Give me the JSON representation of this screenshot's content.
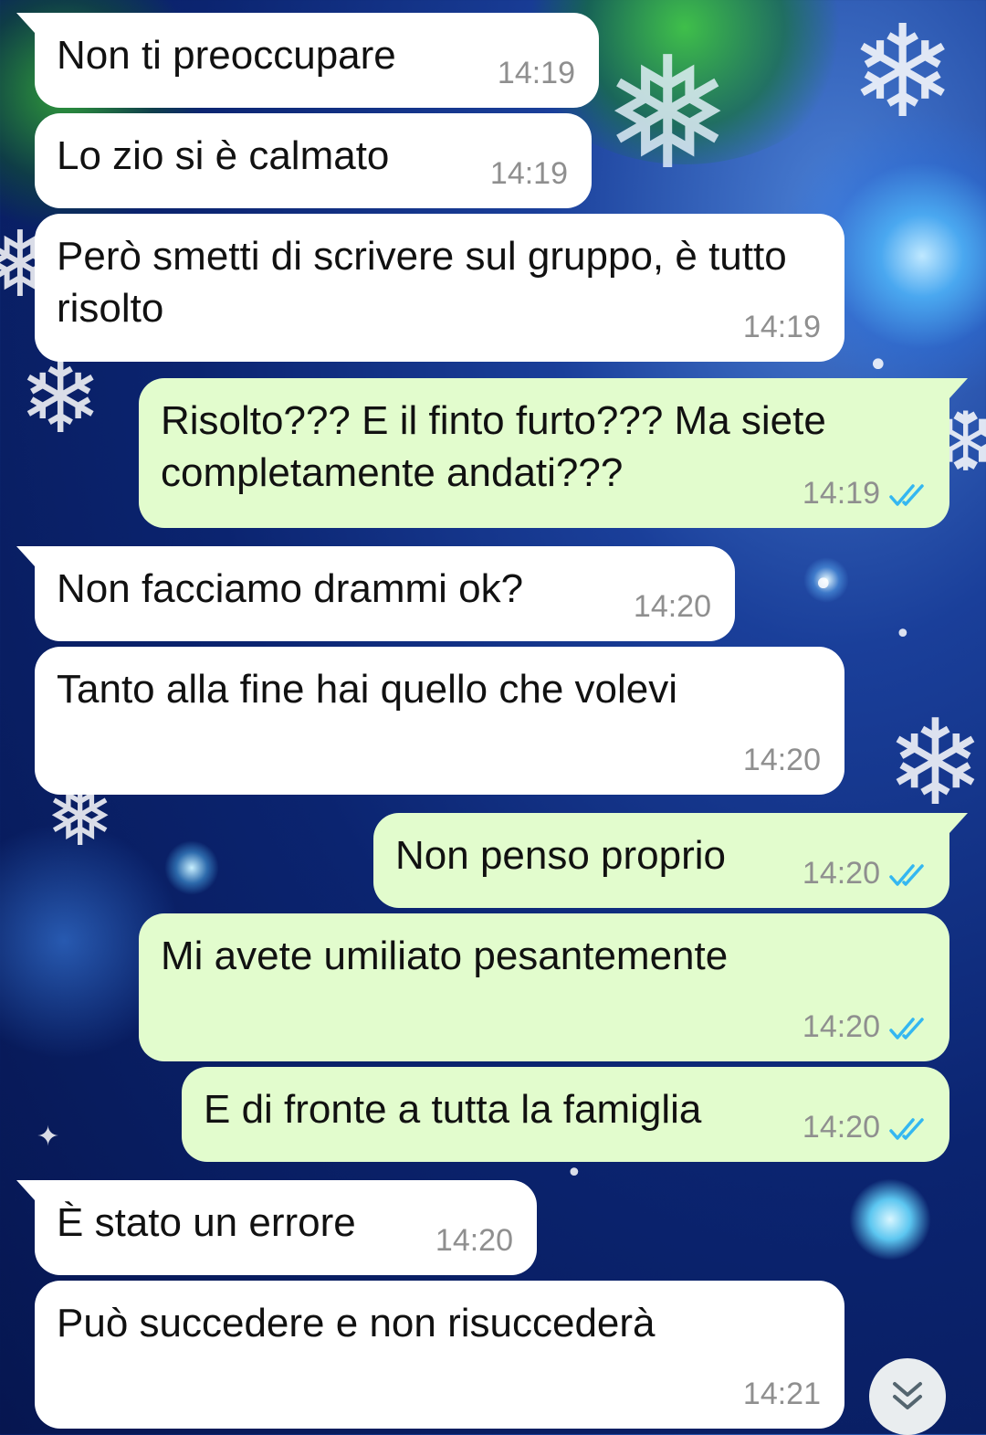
{
  "messages": [
    {
      "dir": "in",
      "text": "Non ti preoccupare",
      "time": "14:19",
      "tail": true
    },
    {
      "dir": "in",
      "text": "Lo zio si è calmato",
      "time": "14:19",
      "tail": false
    },
    {
      "dir": "in",
      "text": "Però smetti di scrivere sul gruppo, è tutto risolto",
      "time": "14:19",
      "tail": false
    },
    {
      "dir": "out",
      "text": "Risolto??? E il finto furto??? Ma siete completamente andati???",
      "time": "14:19",
      "tail": true,
      "status": "read"
    },
    {
      "dir": "in",
      "text": "Non facciamo drammi ok?",
      "time": "14:20",
      "tail": true
    },
    {
      "dir": "in",
      "text": "Tanto alla fine hai quello che volevi",
      "time": "14:20",
      "tail": false
    },
    {
      "dir": "out",
      "text": "Non penso proprio",
      "time": "14:20",
      "tail": true,
      "status": "read"
    },
    {
      "dir": "out",
      "text": "Mi avete umiliato pesantemente",
      "time": "14:20",
      "tail": false,
      "status": "read"
    },
    {
      "dir": "out",
      "text": "E di fronte a tutta la famiglia",
      "time": "14:20",
      "tail": false,
      "status": "read"
    },
    {
      "dir": "in",
      "text": "È stato un errore",
      "time": "14:20",
      "tail": true
    },
    {
      "dir": "in",
      "text": "Può succedere e non risuccederà",
      "time": "14:21",
      "tail": false
    }
  ],
  "scroll_button": {
    "icon": "double-chevron-down-icon"
  },
  "colors": {
    "incoming": "#ffffff",
    "outgoing": "#e2fccd",
    "read_ticks": "#34b7f1",
    "timestamp": "#8f8f8f"
  }
}
